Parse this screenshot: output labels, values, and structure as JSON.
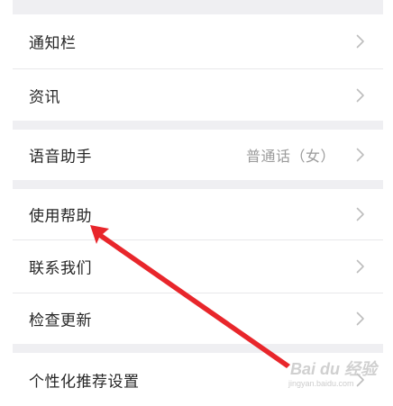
{
  "settings": {
    "items": [
      {
        "label": "通知栏"
      },
      {
        "label": "资讯"
      },
      {
        "label": "语音助手",
        "value": "普通话（女）"
      },
      {
        "label": "使用帮助"
      },
      {
        "label": "联系我们"
      },
      {
        "label": "检查更新"
      },
      {
        "label": "个性化推荐设置"
      }
    ]
  },
  "watermark": {
    "brand": "Bai du 经验",
    "url": "jingyan.baidu.com"
  },
  "colors": {
    "section_gap": "#efeff2",
    "label": "#262626",
    "value": "#9b9b9b",
    "chevron": "#bdbdbd",
    "annotation_arrow": "#e8262b"
  }
}
